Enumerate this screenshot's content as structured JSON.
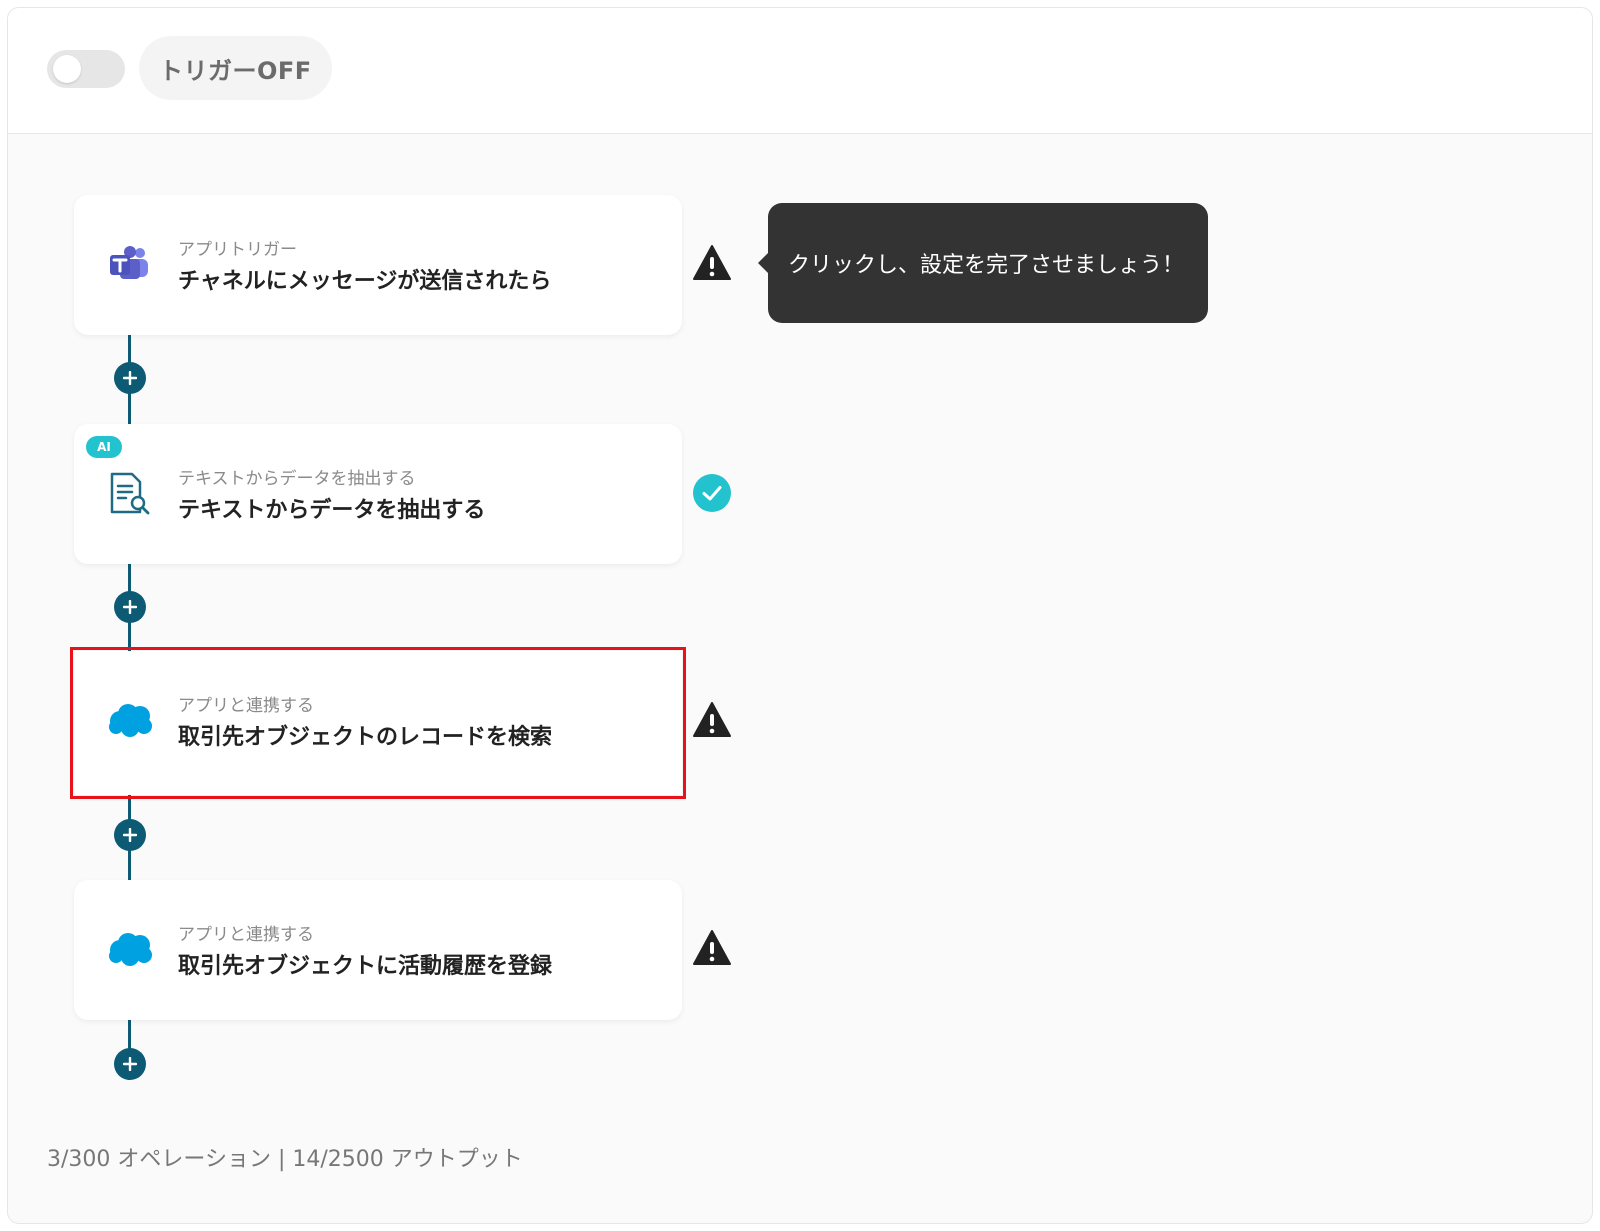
{
  "header": {
    "toggle_state": "off",
    "trigger_label": "トリガーOFF"
  },
  "tooltip": {
    "text": "クリックし、設定を完了させましょう！"
  },
  "steps": [
    {
      "subtitle": "アプリトリガー",
      "title": "チャネルにメッセージが送信されたら",
      "icon": "teams-icon",
      "status": "warning"
    },
    {
      "badge": "AI",
      "subtitle": "テキストからデータを抽出する",
      "title": "テキストからデータを抽出する",
      "icon": "document-search-icon",
      "status": "complete"
    },
    {
      "subtitle": "アプリと連携する",
      "title": "取引先オブジェクトのレコードを検索",
      "icon": "salesforce-cloud-icon",
      "status": "warning",
      "selected": true
    },
    {
      "subtitle": "アプリと連携する",
      "title": "取引先オブジェクトに活動履歴を登録",
      "icon": "salesforce-cloud-icon",
      "status": "warning"
    }
  ],
  "footer": {
    "usage": "3/300 オペレーション | 14/2500 アウトプット"
  },
  "colors": {
    "connector": "#0d5a74",
    "warning": "#222222",
    "complete": "#22c3cf",
    "selection": "#e8131a",
    "teams": "#5b5fc7",
    "salesforce": "#00a1e0"
  }
}
